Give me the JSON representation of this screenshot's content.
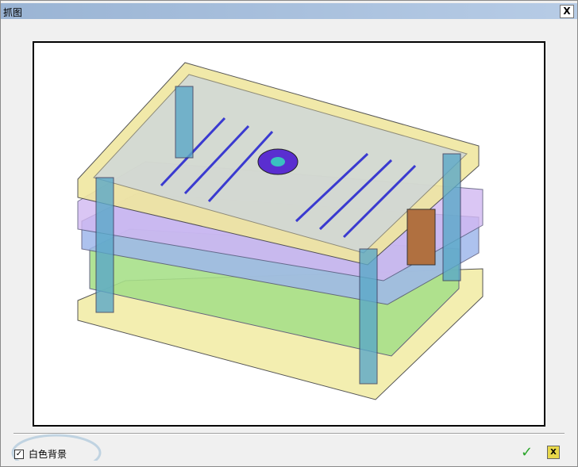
{
  "window": {
    "title": "抓图",
    "close_label": "X"
  },
  "options": {
    "white_background_label": "白色背景",
    "white_background_checked": true,
    "check_mark": "✓"
  },
  "actions": {
    "ok_icon": "check-icon",
    "cancel_icon": "cancel-icon",
    "cancel_glyph": "X"
  }
}
